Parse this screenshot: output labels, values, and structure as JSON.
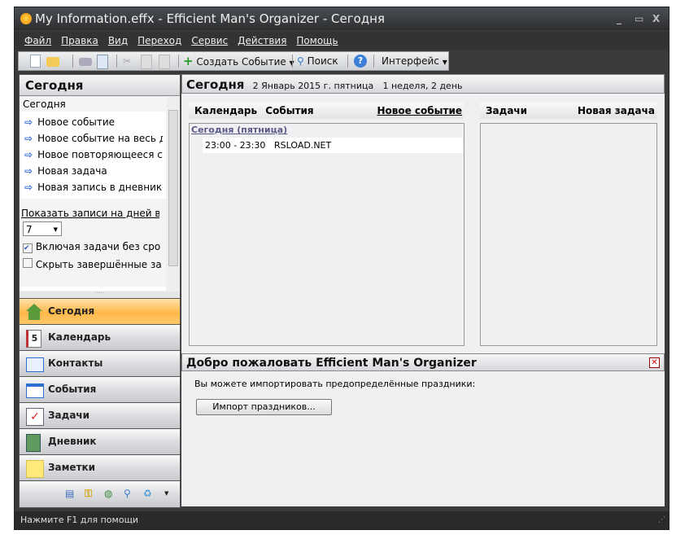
{
  "window": {
    "title": "My Information.effx - Efficient Man's Organizer - Сегодня",
    "minimize": "_",
    "maximize": "▭",
    "close": "X"
  },
  "menu": [
    "Файл",
    "Правка",
    "Вид",
    "Переход",
    "Сервис",
    "Действия",
    "Помощь"
  ],
  "toolbar": {
    "create_event": "Создать Событие",
    "search": "Поиск",
    "interface": "Интерфейс"
  },
  "left": {
    "header": "Сегодня",
    "section": "Сегодня",
    "links": [
      "Новое событие",
      "Новое событие на весь день",
      "Новое повторяющееся событие",
      "Новая задача",
      "Новая запись в дневнике"
    ],
    "show_days_label": "Показать записи на дней вперёд",
    "days_value": "7",
    "include_tasks": {
      "label": "Включая задачи без срока",
      "checked": true
    },
    "hide_completed": {
      "label": "Скрыть завершённые задачи",
      "checked": false
    },
    "nav": [
      "Сегодня",
      "Календарь",
      "Контакты",
      "События",
      "Задачи",
      "Дневник",
      "Заметки"
    ]
  },
  "main": {
    "title": "Сегодня",
    "date": "2 Январь 2015 г. пятница",
    "week": "1 неделя, 2 день",
    "cal_tab": "Календарь",
    "events_tab": "События",
    "new_event": "Новое событие",
    "tasks": "Задачи",
    "new_task": "Новая задача",
    "day_header": "Сегодня (пятница)",
    "events": [
      {
        "time": "23:00 - 23:30",
        "title": "RSLOAD.NET"
      }
    ],
    "welcome": {
      "title": "Добро пожаловать Efficient Man's Organizer",
      "text": "Вы можете импортировать предопределённые праздники:",
      "button": "Импорт праздников..."
    }
  },
  "status": "Нажмите F1 для помощи"
}
